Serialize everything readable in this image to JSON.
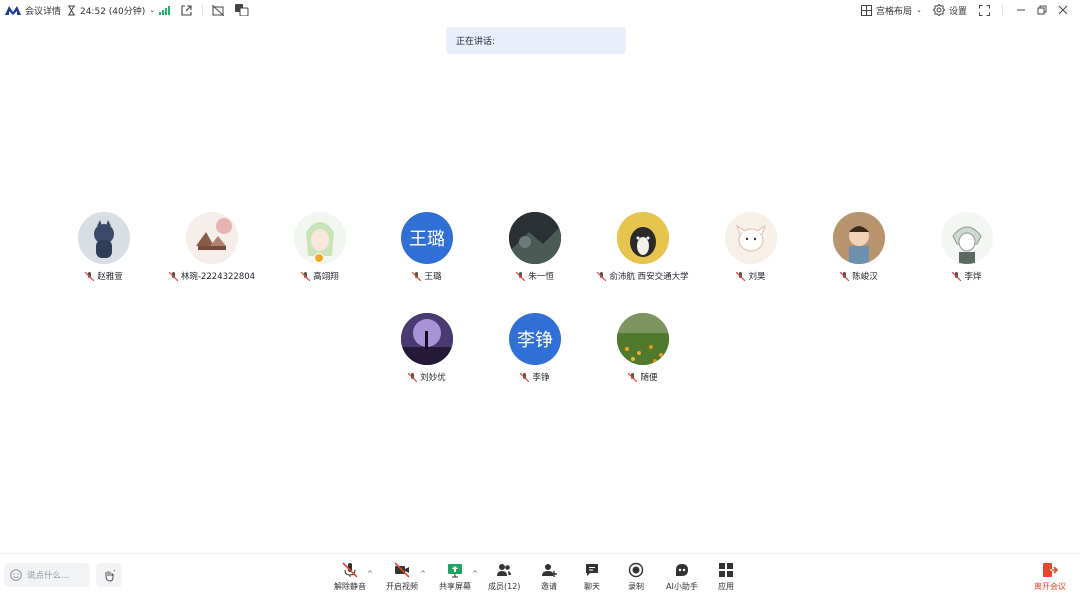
{
  "topbar": {
    "meeting_details": "会议详情",
    "timer": "24:52 (40分钟)",
    "layout_label": "宫格布局",
    "settings_label": "设置"
  },
  "speaker_banner": {
    "label": "正在讲话:"
  },
  "participants": [
    {
      "name": "赵雅萱"
    },
    {
      "name": "林琬-2224322804"
    },
    {
      "name": "高翊翔"
    },
    {
      "name": "王璐",
      "avatar_text": "王璐"
    },
    {
      "name": "朱一恒"
    },
    {
      "name": "俞沛航 西安交通大学"
    },
    {
      "name": "刘昊"
    },
    {
      "name": "陈峻汉"
    },
    {
      "name": "李烨"
    },
    {
      "name": "刘妙优"
    },
    {
      "name": "李铮",
      "avatar_text": "李铮"
    },
    {
      "name": "随便"
    }
  ],
  "bottombar": {
    "chat_placeholder": "说点什么...",
    "tools": {
      "unmute": "解除静音",
      "video": "开启视频",
      "share": "共享屏幕",
      "members": "成员(12)",
      "invite": "邀请",
      "chat": "聊天",
      "record": "录制",
      "ai": "AI小助手",
      "apps": "应用"
    },
    "leave": "离开会议"
  },
  "colors": {
    "accent": "#2f6fd6",
    "leave": "#e8452c",
    "banner": "#e9eefb"
  }
}
